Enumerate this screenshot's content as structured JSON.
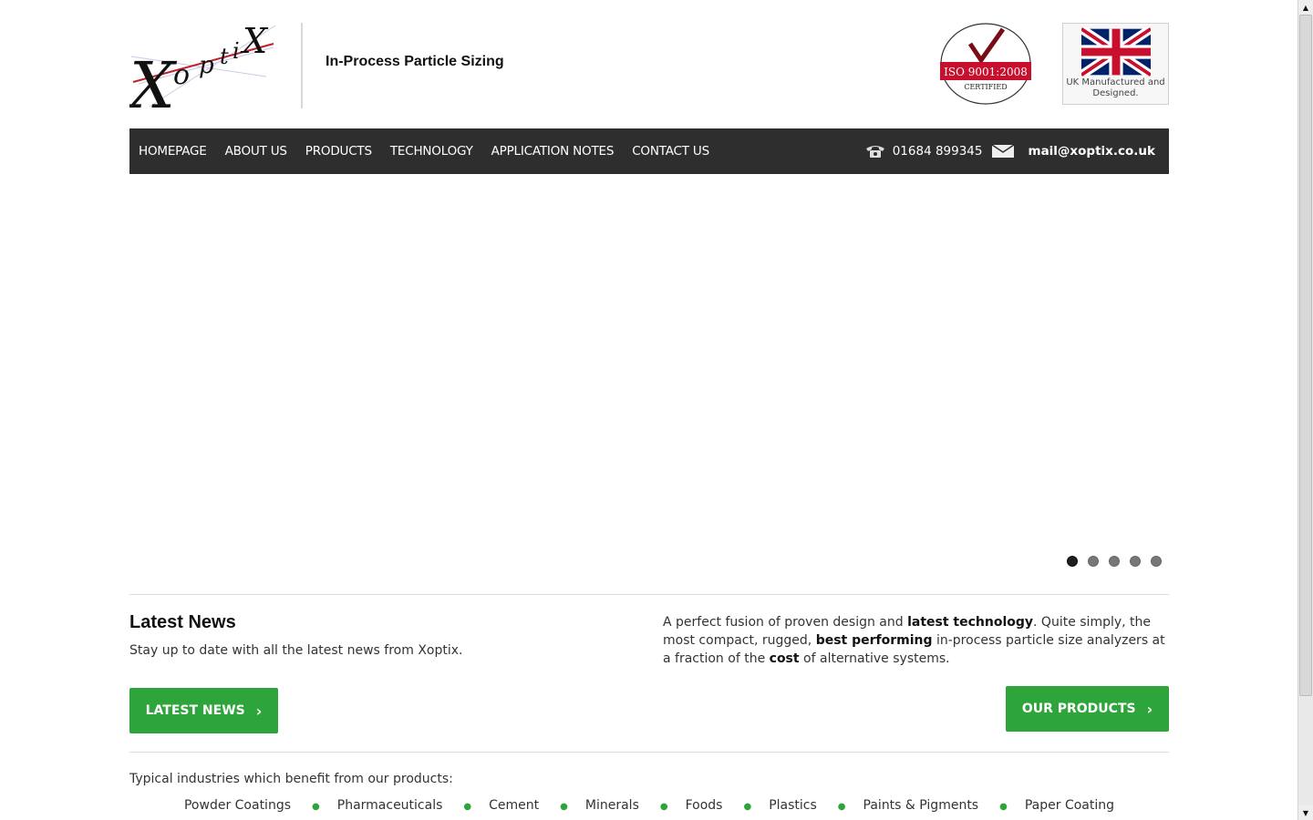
{
  "header": {
    "logo_text": "XoptiX",
    "tagline": "In-Process Particle Sizing",
    "iso_badge": {
      "text": "ISO 9001:2008",
      "sub": "CERTIFIED",
      "color": "#c8102e"
    },
    "uk_badge": {
      "caption": "UK Manufactured and Designed."
    }
  },
  "nav": {
    "links": [
      "HOMEPAGE",
      "ABOUT US",
      "PRODUCTS",
      "TECHNOLOGY",
      "APPLICATION NOTES",
      "CONTACT US"
    ],
    "phone": "01684 899345",
    "email": "mail@xoptix.co.uk",
    "phone_icon": "phone-icon",
    "mail_icon": "mail-icon",
    "bg_color": "#2e2e2e"
  },
  "slider": {
    "dots": 5,
    "active_dot": 1
  },
  "news": {
    "title": "Latest News",
    "subtitle": "Stay up to date with all the latest news from Xoptix.",
    "button": "LATEST NEWS"
  },
  "about": {
    "part1": "A perfect fusion of proven design and ",
    "bold1": "latest technology",
    "part2": ". Quite simply, the most compact, rugged, ",
    "bold2": "best performing",
    "part3": " in-process particle size analyzers at a fraction of the ",
    "bold3": "cost",
    "part4": " of alternative systems.",
    "button": "OUR PRODUCTS"
  },
  "industries": {
    "title": "Typical industries which benefit from our products:",
    "items": [
      "Powder Coatings",
      "Pharmaceuticals",
      "Cement",
      "Minerals",
      "Foods",
      "Plastics",
      "Paints & Pigments",
      "Paper Coating"
    ]
  },
  "colors": {
    "accent_green": "#2ea53a",
    "nav_dark": "#2e2e2e"
  }
}
